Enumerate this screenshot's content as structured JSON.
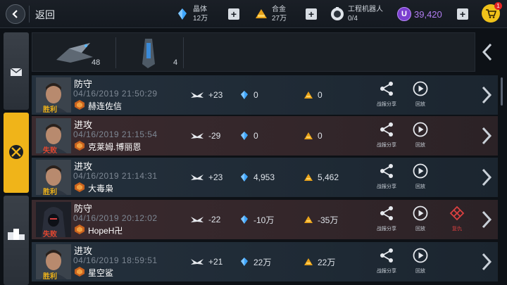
{
  "header": {
    "back_label": "返回",
    "resources": [
      {
        "name": "晶体",
        "value": "12万",
        "icon": "crystal-icon"
      },
      {
        "name": "合金",
        "value": "27万",
        "icon": "alloy-icon"
      },
      {
        "name": "工程机器人",
        "value": "0/4",
        "icon": "robot-icon"
      }
    ],
    "premium": {
      "icon_letter": "U",
      "value": "39,420"
    },
    "cart_badge": "1"
  },
  "fleet": {
    "ships": [
      {
        "icon": "fighter-ship-icon",
        "count": "48"
      },
      {
        "icon": "frigate-ship-icon",
        "count": "4"
      }
    ]
  },
  "actions": {
    "share": "战报分享",
    "replay": "回放",
    "revenge": "复仇"
  },
  "battles": [
    {
      "type": "防守",
      "time": "04/16/2019 21:50:29",
      "result": "胜利",
      "opponent": "赫连佐信",
      "medal": "+23",
      "crystal": "0",
      "alloy": "0",
      "style": "def",
      "revenge": false
    },
    {
      "type": "进攻",
      "time": "04/16/2019 21:15:54",
      "result": "失败",
      "opponent": "克莱姆.博丽恩",
      "medal": "-29",
      "crystal": "0",
      "alloy": "0",
      "style": "atk",
      "revenge": false
    },
    {
      "type": "进攻",
      "time": "04/16/2019 21:14:31",
      "result": "胜利",
      "opponent": "大毒枭",
      "medal": "+23",
      "crystal": "4,953",
      "alloy": "5,462",
      "style": "def",
      "revenge": false
    },
    {
      "type": "防守",
      "time": "04/16/2019 20:12:02",
      "result": "失败",
      "opponent": "HopeH卍",
      "medal": "-22",
      "crystal": "-10万",
      "alloy": "-35万",
      "style": "atk",
      "revenge": true
    },
    {
      "type": "进攻",
      "time": "04/16/2019 18:59:51",
      "result": "胜利",
      "opponent": "星空鲨",
      "medal": "+21",
      "crystal": "22万",
      "alloy": "22万",
      "style": "def",
      "revenge": false
    }
  ],
  "colors": {
    "accent": "#f0b419",
    "lose": "#e6472f",
    "premium": "#b07cf0"
  }
}
